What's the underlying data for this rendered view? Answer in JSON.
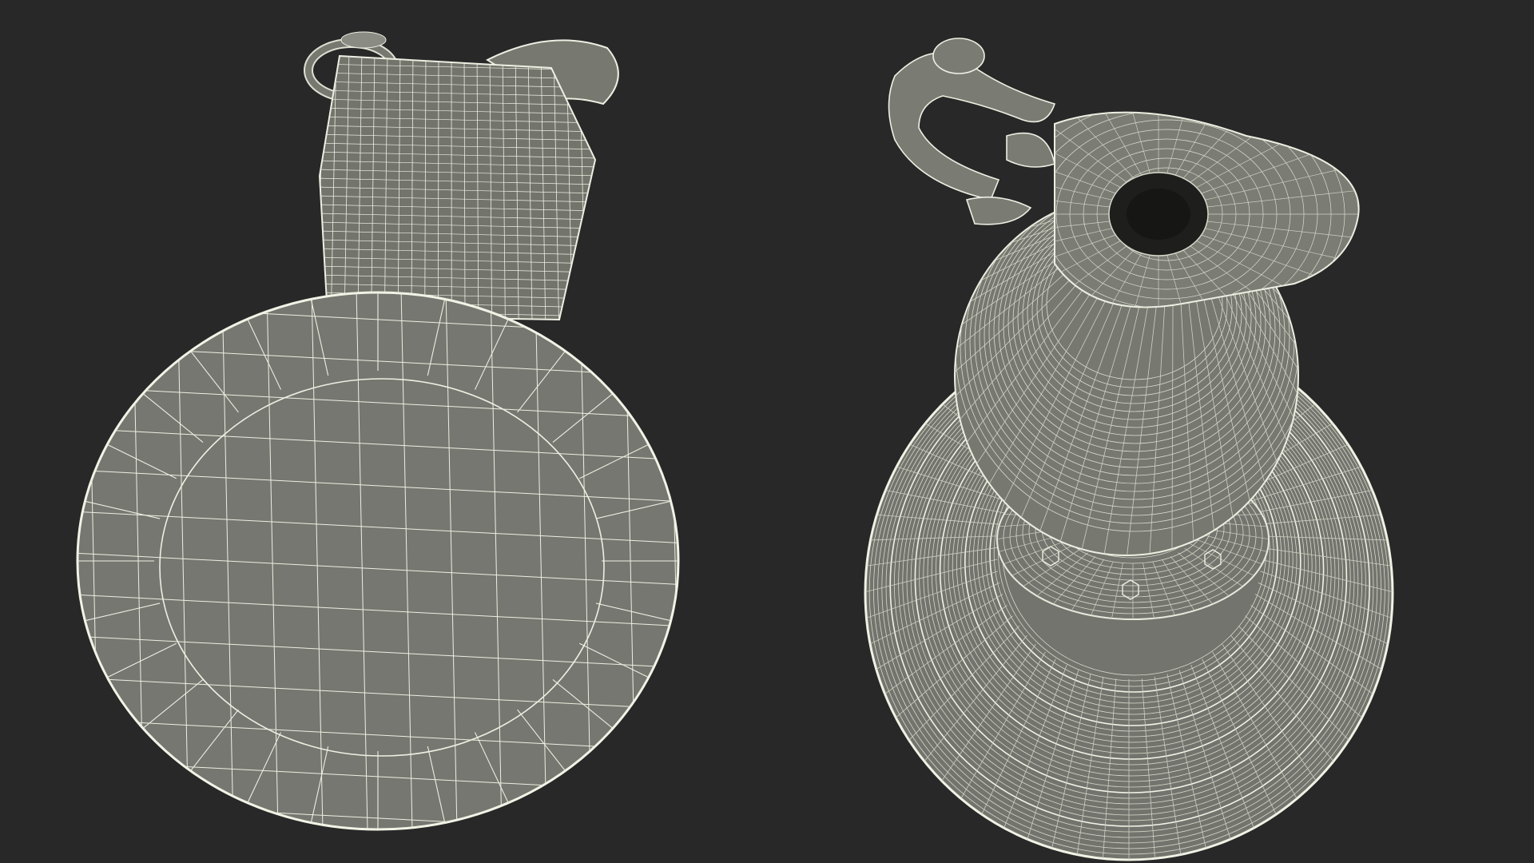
{
  "scene": {
    "background_color": "#282828",
    "mesh_fill_color": "#777870",
    "mesh_fill_dark": "#6a6b64",
    "wire_color": "#eeefe2",
    "wire_color_soft": "#d8d9cc"
  },
  "views": [
    {
      "name": "jug-bottom-view",
      "description_hidden": true
    },
    {
      "name": "jug-top-view",
      "description_hidden": true
    }
  ]
}
